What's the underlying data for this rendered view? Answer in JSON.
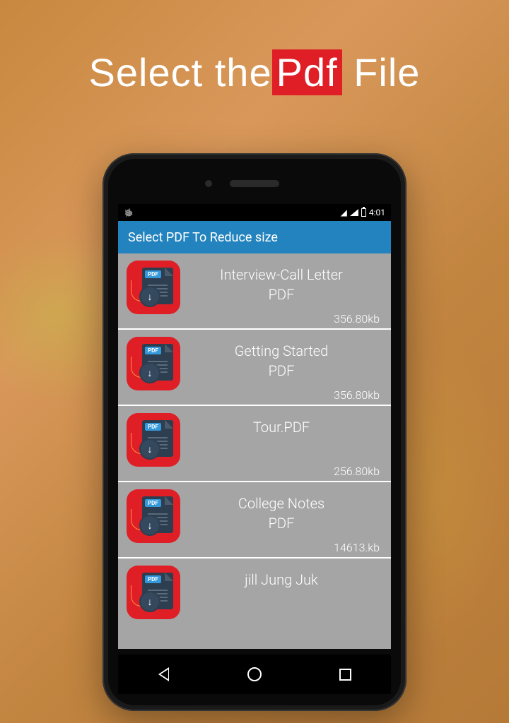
{
  "headline": {
    "part1": "Select the",
    "highlight": "Pdf",
    "part2": " File"
  },
  "status": {
    "time": "4:01"
  },
  "app": {
    "title": "Select PDF To Reduce size"
  },
  "files": [
    {
      "name": "Interview-Call Letter",
      "type": "PDF",
      "size": "356.80kb"
    },
    {
      "name": "Getting Started",
      "type": "PDF",
      "size": "356.80kb"
    },
    {
      "name": "Tour.PDF",
      "type": "",
      "size": "256.80kb"
    },
    {
      "name": "College Notes",
      "type": "PDF",
      "size": "14613.kb"
    },
    {
      "name": "jill Jung Juk",
      "type": "",
      "size": ""
    }
  ],
  "icon": {
    "pdf_label": "PDF"
  }
}
